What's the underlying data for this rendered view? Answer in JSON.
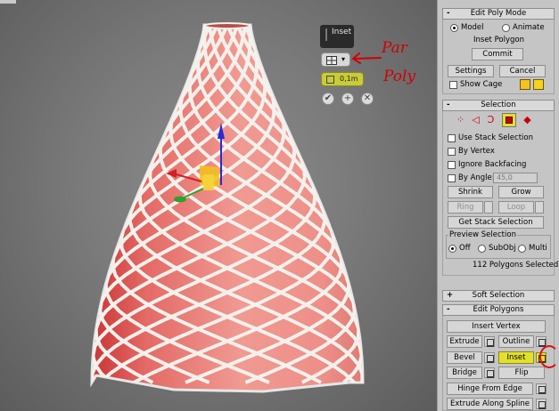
{
  "caddy": {
    "title": "Inset",
    "type_icon": "grid-icon",
    "amount": "0,1m",
    "ok_icon": "check-icon",
    "apply_icon": "plus-icon",
    "cancel_icon": "x-icon"
  },
  "annotation": {
    "line1": "Par",
    "line2": "Poly"
  },
  "edit_poly_mode": {
    "header": "Edit Poly Mode",
    "model_label": "Model",
    "animate_label": "Animate",
    "operation": "Inset Polygon",
    "commit": "Commit",
    "settings": "Settings",
    "cancel": "Cancel",
    "show_cage": "Show Cage",
    "cage_color_1": "#f5c21f",
    "cage_color_2": "#f7d21a"
  },
  "selection": {
    "header": "Selection",
    "subobject_icons": [
      "vertex-icon",
      "edge-icon",
      "border-icon",
      "polygon-icon",
      "element-icon"
    ],
    "use_stack": "Use Stack Selection",
    "by_vertex": "By Vertex",
    "ignore_backfacing": "Ignore Backfacing",
    "by_angle": "By Angle:",
    "angle_value": "45,0",
    "shrink": "Shrink",
    "grow": "Grow",
    "ring": "Ring",
    "loop": "Loop",
    "get_stack": "Get Stack Selection",
    "preview_label": "Preview Selection",
    "preview_off": "Off",
    "preview_subobj": "SubObj",
    "preview_multi": "Multi",
    "status": "112 Polygons Selected"
  },
  "soft_selection": {
    "header": "Soft Selection"
  },
  "edit_polygons": {
    "header": "Edit Polygons",
    "insert_vertex": "Insert Vertex",
    "extrude": "Extrude",
    "outline": "Outline",
    "bevel": "Bevel",
    "inset": "Inset",
    "bridge": "Bridge",
    "flip": "Flip",
    "hinge": "Hinge From Edge",
    "extrude_spline": "Extrude Along Spline"
  },
  "colors": {
    "viewport": "#7a7a7a",
    "panel": "#c5c5c5",
    "selected_face": "#e8726e",
    "active_button": "#e3e02c",
    "annotation": "#d10000"
  }
}
